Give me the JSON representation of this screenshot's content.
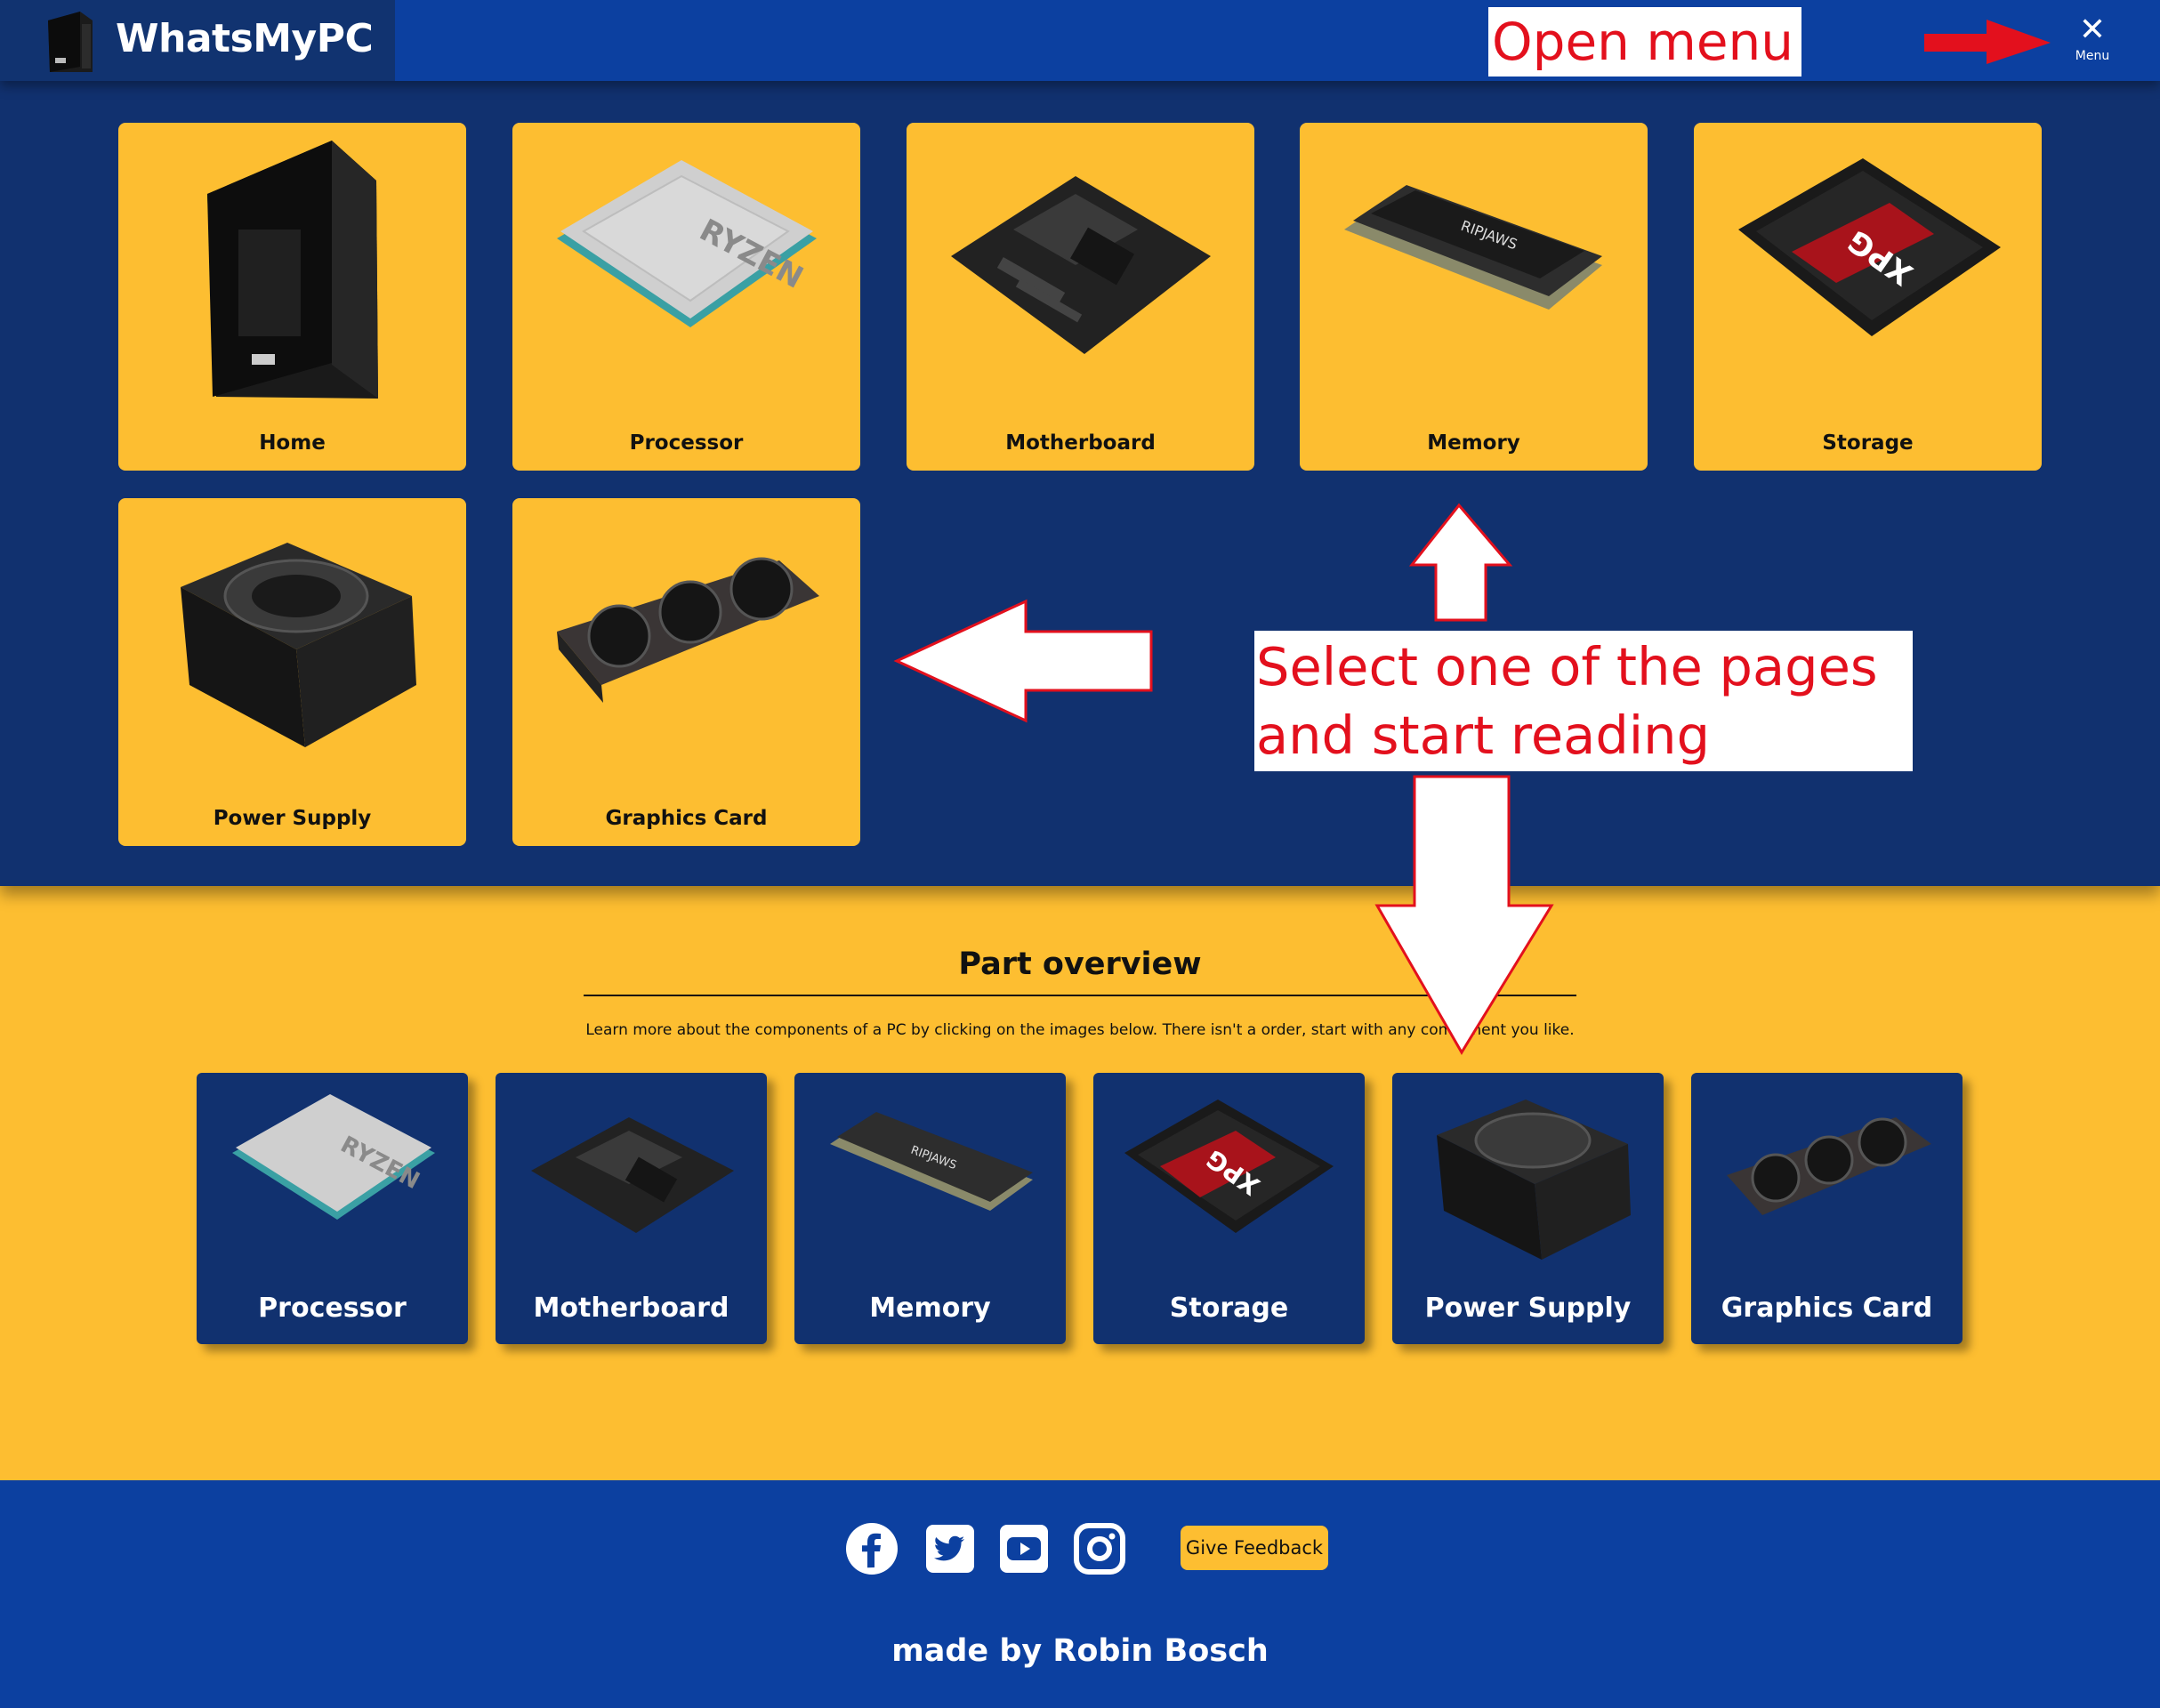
{
  "header": {
    "brand_name": "WhatsMyPC",
    "menu_label": "Menu",
    "menu_icon": "close-icon"
  },
  "nav_cards": [
    {
      "label": "Home",
      "image": "pc-case-image"
    },
    {
      "label": "Processor",
      "image": "processor-image"
    },
    {
      "label": "Motherboard",
      "image": "motherboard-image"
    },
    {
      "label": "Memory",
      "image": "memory-image"
    },
    {
      "label": "Storage",
      "image": "ssd-image"
    },
    {
      "label": "Power Supply",
      "image": "power-supply-image"
    },
    {
      "label": "Graphics Card",
      "image": "graphics-card-image"
    }
  ],
  "part_overview": {
    "title": "Part overview",
    "description": "Learn more about the components of a PC by clicking on the images below. There isn't a order, start with any component you like.",
    "cards": [
      {
        "label": "Processor",
        "image": "processor-image"
      },
      {
        "label": "Motherboard",
        "image": "motherboard-image"
      },
      {
        "label": "Memory",
        "image": "memory-image"
      },
      {
        "label": "Storage",
        "image": "ssd-image"
      },
      {
        "label": "Power Supply",
        "image": "power-supply-image"
      },
      {
        "label": "Graphics Card",
        "image": "graphics-card-image"
      }
    ]
  },
  "footer": {
    "social_icons": [
      "facebook-icon",
      "twitter-icon",
      "youtube-icon",
      "instagram-icon"
    ],
    "feedback_label": "Give Feedback",
    "made_by": "made by Robin Bosch"
  },
  "annotations": {
    "open_menu": "Open menu",
    "select_line1": "Select one of the pages",
    "select_line2": "and start reading",
    "color": "#e3101d"
  },
  "colors": {
    "navy": "#11316f",
    "header_blue": "#0c40a0",
    "accent_yellow": "#fdbe31"
  }
}
